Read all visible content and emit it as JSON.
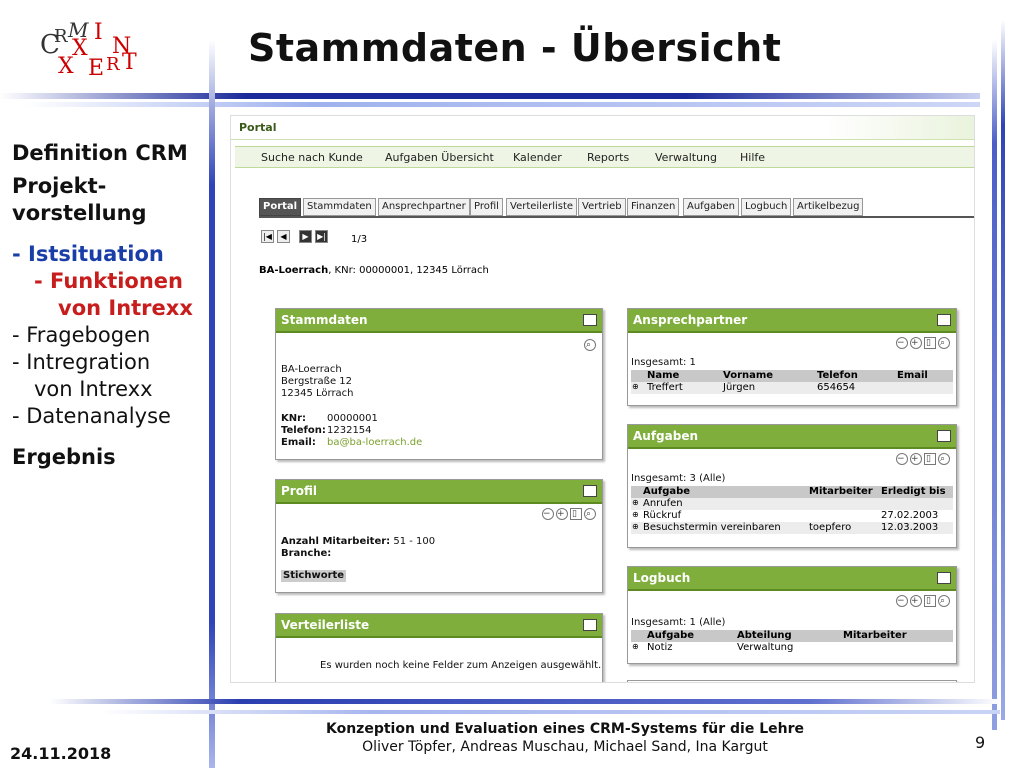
{
  "slide": {
    "title": "Stammdaten - Übersicht",
    "logo": {
      "c": "C",
      "r": "R",
      "m": "M",
      "i": "I",
      "n": "N",
      "x1": "X",
      "x2": "X",
      "e": "E",
      "r2": "R",
      "t": "T"
    },
    "footer_line1": "Konzeption und Evaluation eines CRM-Systems für die Lehre",
    "footer_line2": "Oliver Töpfer, Andreas Muschau, Michael Sand, Ina Kargut",
    "date": "24.11.2018",
    "page": "9"
  },
  "nav": {
    "definition": "Definition CRM",
    "projekt1": "Projekt-",
    "projekt2": "vorstellung",
    "ist": "- Istsituation",
    "funktionen1": "- Funktionen",
    "funktionen2": "von Intrexx",
    "fragebogen": "- Fragebogen",
    "integration1": "- Intregration",
    "integration2": "von Intrexx",
    "datenanalyse": "- Datenanalyse",
    "ergebnis": "Ergebnis"
  },
  "app": {
    "portal_label": "Portal",
    "menu": [
      "Suche nach Kunde",
      "Aufgaben Übersicht",
      "Kalender",
      "Reports",
      "Verwaltung",
      "Hilfe"
    ],
    "tabs": [
      "Portal",
      "Stammdaten",
      "Ansprechpartner",
      "Profil",
      "Verteilerliste",
      "Vertrieb",
      "Finanzen",
      "Aufgaben",
      "Logbuch",
      "Artikelbezug"
    ],
    "pager_text": "1/3",
    "record_name": "BA-Loerrach",
    "record_detail": ", KNr: 00000001, 12345 Lörrach",
    "stammdaten": {
      "title": "Stammdaten",
      "addr1": "BA-Loerrach",
      "addr2": "Bergstraße 12",
      "addr3": "12345 Lörrach",
      "knr_label": "KNr:",
      "knr": "00000001",
      "tel_label": "Telefon:",
      "tel": "1232154",
      "email_label": "Email:",
      "email": "ba@ba-loerrach.de"
    },
    "profil": {
      "title": "Profil",
      "mitarbeiter_label": "Anzahl Mitarbeiter:",
      "mitarbeiter": "51 - 100",
      "branche_label": "Branche:",
      "stichworte": "Stichworte"
    },
    "verteilerliste": {
      "title": "Verteilerliste",
      "empty": "Es wurden noch keine Felder zum Anzeigen ausgewählt."
    },
    "ansprechpartner": {
      "title": "Ansprechpartner",
      "total": "Insgesamt: 1",
      "headers": [
        "Name",
        "Vorname",
        "Telefon",
        "Email"
      ],
      "rows": [
        [
          "Treffert",
          "Jürgen",
          "654654",
          ""
        ]
      ]
    },
    "aufgaben": {
      "title": "Aufgaben",
      "total": "Insgesamt: 3 (Alle)",
      "headers": [
        "Aufgabe",
        "Mitarbeiter",
        "Erledigt bis"
      ],
      "rows": [
        [
          "Anrufen",
          "",
          ""
        ],
        [
          "Rückruf",
          "",
          "27.02.2003"
        ],
        [
          "Besuchstermin vereinbaren",
          "toepfero",
          "12.03.2003"
        ]
      ]
    },
    "logbuch": {
      "title": "Logbuch",
      "total": "Insgesamt: 1 (Alle)",
      "headers": [
        "Aufgabe",
        "Abteilung",
        "Mitarbeiter"
      ],
      "rows": [
        [
          "Notiz",
          "Verwaltung",
          ""
        ]
      ]
    }
  }
}
